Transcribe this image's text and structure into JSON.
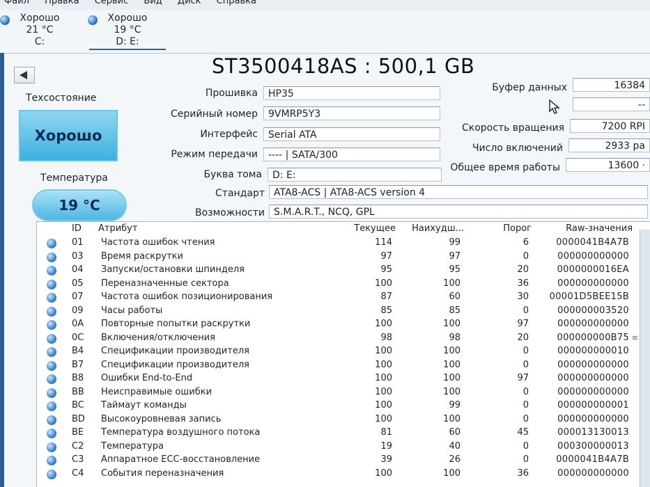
{
  "menu": [
    "Файл",
    "Правка",
    "Сервис",
    "Вид",
    "Диск",
    "Справка"
  ],
  "disks": [
    {
      "status": "Хорошо",
      "temp": "21 °C",
      "letters": "C:"
    },
    {
      "status": "Хорошо",
      "temp": "19 °C",
      "letters": "D: E:"
    }
  ],
  "drive": {
    "title": "ST3500418AS : 500,1 GB",
    "health_caption": "Техсостояние",
    "health_value": "Хорошо",
    "temp_caption": "Температура",
    "temp_value": "19 °C",
    "left_fields": [
      {
        "label": "Прошивка",
        "value": "HP35"
      },
      {
        "label": "Серийный номер",
        "value": "9VMRP5Y3"
      },
      {
        "label": "Интерфейс",
        "value": "Serial ATA"
      },
      {
        "label": "Режим передачи",
        "value": "---- | SATA/300"
      },
      {
        "label": "Буква тома",
        "value": "D: E:"
      },
      {
        "label": "Стандарт",
        "value": "ATA8-ACS | ATA8-ACS version 4"
      },
      {
        "label": "Возможности",
        "value": "S.M.A.R.T., NCQ, GPL"
      }
    ],
    "right_fields": [
      {
        "label": "Буфер данных",
        "value": "16384"
      },
      {
        "label": "",
        "value": "--"
      },
      {
        "label": "Скорость вращения",
        "value": "7200 RPI"
      },
      {
        "label": "Число включений",
        "value": "2933 ра"
      },
      {
        "label": "Общее время работы",
        "value": "13600 ·"
      }
    ]
  },
  "table": {
    "headers": [
      "ID",
      "Атрибут",
      "Текущее",
      "Наихудш...",
      "Порог",
      "Raw-значения"
    ],
    "rows": [
      {
        "id": "01",
        "name": "Частота ошибок чтения",
        "cur": "114",
        "worst": "99",
        "thr": "6",
        "raw": "0000041B4A7B"
      },
      {
        "id": "03",
        "name": "Время раскрутки",
        "cur": "97",
        "worst": "97",
        "thr": "0",
        "raw": "000000000000"
      },
      {
        "id": "04",
        "name": "Запуски/остановки шпинделя",
        "cur": "95",
        "worst": "95",
        "thr": "20",
        "raw": "0000000016EA"
      },
      {
        "id": "05",
        "name": "Переназначенные сектора",
        "cur": "100",
        "worst": "100",
        "thr": "36",
        "raw": "000000000000"
      },
      {
        "id": "07",
        "name": "Частота ошибок позиционирования",
        "cur": "87",
        "worst": "60",
        "thr": "30",
        "raw": "00001D5BEE15B"
      },
      {
        "id": "09",
        "name": "Часы работы",
        "cur": "85",
        "worst": "85",
        "thr": "0",
        "raw": "000000003520"
      },
      {
        "id": "0A",
        "name": "Повторные попытки раскрутки",
        "cur": "100",
        "worst": "100",
        "thr": "97",
        "raw": "000000000000"
      },
      {
        "id": "0C",
        "name": "Включения/отключения",
        "cur": "98",
        "worst": "98",
        "thr": "20",
        "raw": "000000000B75"
      },
      {
        "id": "B4",
        "name": "Спецификации производителя",
        "cur": "100",
        "worst": "100",
        "thr": "0",
        "raw": "000000000010"
      },
      {
        "id": "B7",
        "name": "Спецификации производителя",
        "cur": "100",
        "worst": "100",
        "thr": "0",
        "raw": "000000000000"
      },
      {
        "id": "B8",
        "name": "Ошибки End-to-End",
        "cur": "100",
        "worst": "100",
        "thr": "97",
        "raw": "000000000000"
      },
      {
        "id": "BB",
        "name": "Неисправимые ошибки",
        "cur": "100",
        "worst": "100",
        "thr": "0",
        "raw": "000000000000"
      },
      {
        "id": "BC",
        "name": "Таймаут команды",
        "cur": "100",
        "worst": "99",
        "thr": "0",
        "raw": "000000000001"
      },
      {
        "id": "BD",
        "name": "Высокоуровневая запись",
        "cur": "100",
        "worst": "100",
        "thr": "0",
        "raw": "000000000000"
      },
      {
        "id": "BE",
        "name": "Температура воздушного потока",
        "cur": "81",
        "worst": "60",
        "thr": "45",
        "raw": "000013130013"
      },
      {
        "id": "C2",
        "name": "Температура",
        "cur": "19",
        "worst": "40",
        "thr": "0",
        "raw": "000300000013"
      },
      {
        "id": "C3",
        "name": "Аппаратное ECC-восстановление",
        "cur": "39",
        "worst": "26",
        "thr": "0",
        "raw": "0000041B4A7B"
      },
      {
        "id": "C4",
        "name": "События переназначения",
        "cur": "100",
        "worst": "100",
        "thr": "36",
        "raw": "000000000000"
      }
    ]
  }
}
